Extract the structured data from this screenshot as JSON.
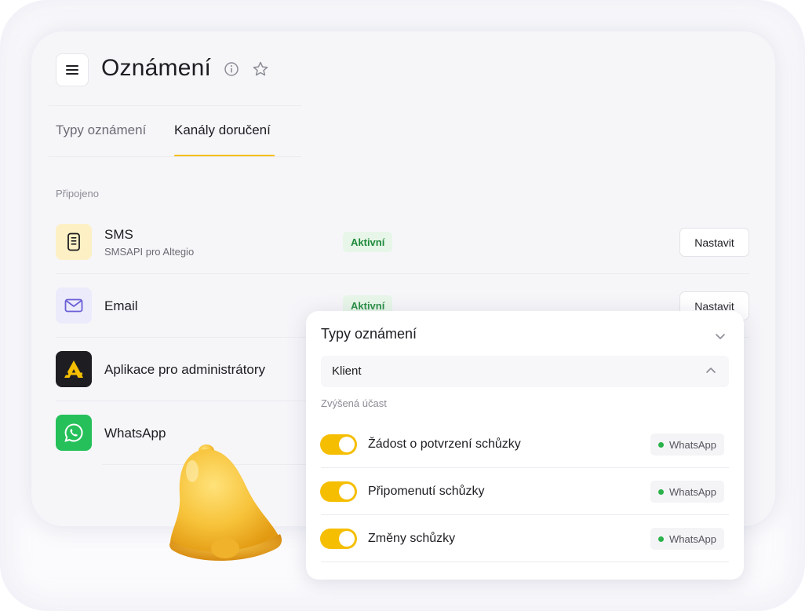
{
  "header": {
    "title": "Oznámení",
    "menu_icon": "hamburger-menu-icon",
    "info_icon": "info-icon",
    "favorite_icon": "star-icon"
  },
  "tabs": [
    {
      "label": "Typy oznámení",
      "active": false
    },
    {
      "label": "Kanály doručení",
      "active": true
    }
  ],
  "connected": {
    "label": "Připojeno",
    "channels": [
      {
        "title": "SMS",
        "subtitle": "SMSAPI pro Altegio",
        "status": "Aktivní",
        "action": "Nastavit",
        "icon": "sms-device-icon"
      },
      {
        "title": "Email",
        "subtitle": "",
        "status": "Aktivní",
        "action": "Nastavit",
        "icon": "envelope-icon"
      },
      {
        "title": "Aplikace pro administrátory",
        "subtitle": "",
        "status": "",
        "action": "",
        "icon": "altegio-logo-icon"
      },
      {
        "title": "WhatsApp",
        "subtitle": "",
        "status": "",
        "action": "",
        "icon": "whatsapp-icon"
      }
    ]
  },
  "popup": {
    "title": "Typy oznámení",
    "select_value": "Klient",
    "group_label": "Zvýšená účast",
    "items": [
      {
        "label": "Žádost o potvrzení schůzky",
        "enabled": true,
        "channel": "WhatsApp"
      },
      {
        "label": "Připomenutí schůzky",
        "enabled": true,
        "channel": "WhatsApp"
      },
      {
        "label": "Změny schůzky",
        "enabled": true,
        "channel": "WhatsApp"
      }
    ]
  },
  "colors": {
    "accent": "#f5be00",
    "active_badge_bg": "#e7f6e8",
    "active_badge_text": "#1f8a3b",
    "whatsapp": "#25c05a"
  },
  "decoration": {
    "bell": "bell-illustration"
  }
}
